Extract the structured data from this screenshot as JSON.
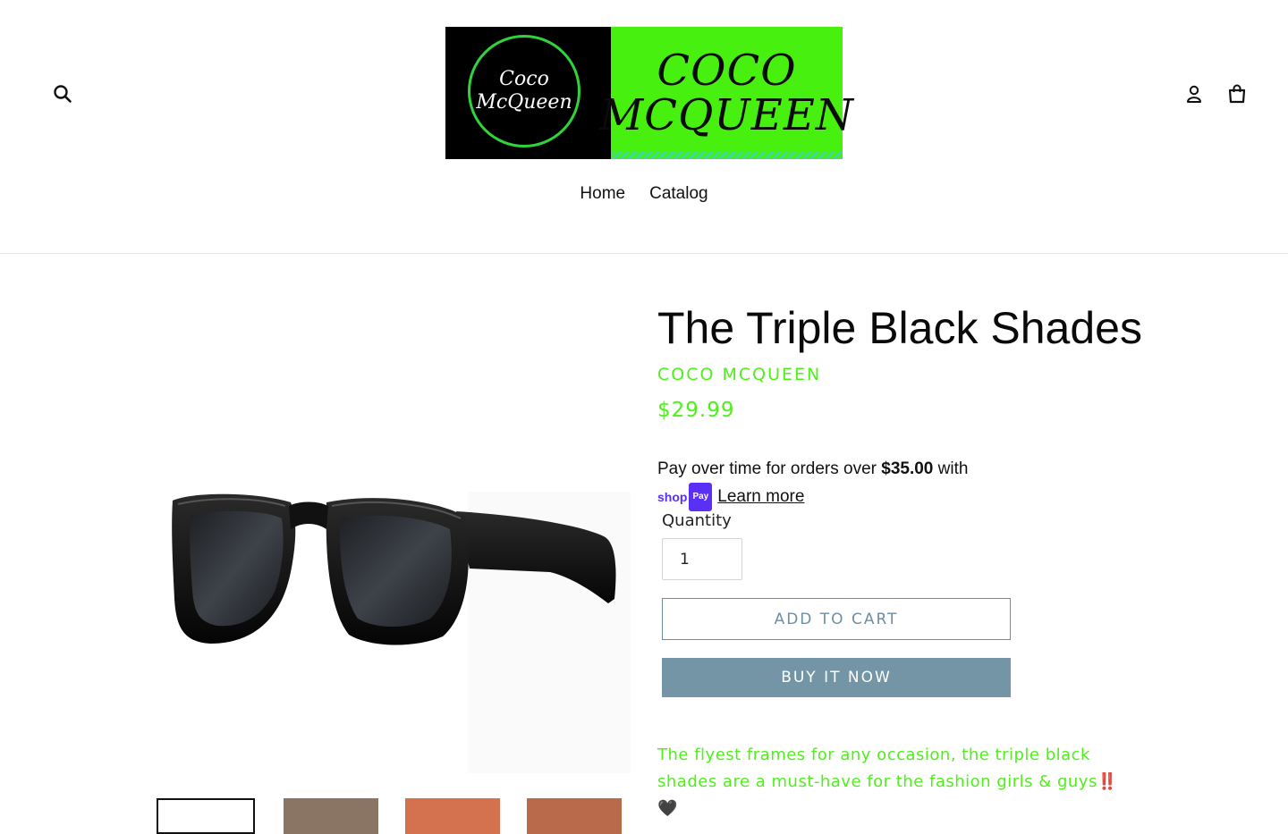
{
  "header": {
    "logo": {
      "circle_line1": "Coco",
      "circle_line2": "McQueen",
      "banner_line1": "COCO",
      "banner_line2": "MCQUEEN"
    },
    "nav": [
      {
        "label": "Home"
      },
      {
        "label": "Catalog"
      }
    ],
    "icons": {
      "search": "search-icon",
      "login": "user-icon",
      "cart": "cart-icon"
    }
  },
  "product": {
    "title": "The Triple Black Shades",
    "vendor": "COCO MCQUEEN",
    "price": "$29.99",
    "installments": {
      "text_before": "Pay over time for orders over ",
      "threshold": "$35.00",
      "text_after": " with",
      "brand_shop": "shop",
      "brand_pay": "Pay",
      "learn_more": "Learn more"
    },
    "quantity_label": "Quantity",
    "quantity_value": "1",
    "add_to_cart": "ADD TO CART",
    "buy_now": "BUY IT NOW",
    "description": "The flyest frames for any occasion, the triple black shades are a must-have for the fashion girls & guys",
    "description_emoji": "‼️",
    "description_emoji2": "🖤"
  },
  "colors": {
    "accent_green": "#4ff01a",
    "button_blue": "#7495a6",
    "button_outline": "#6f8da3"
  }
}
